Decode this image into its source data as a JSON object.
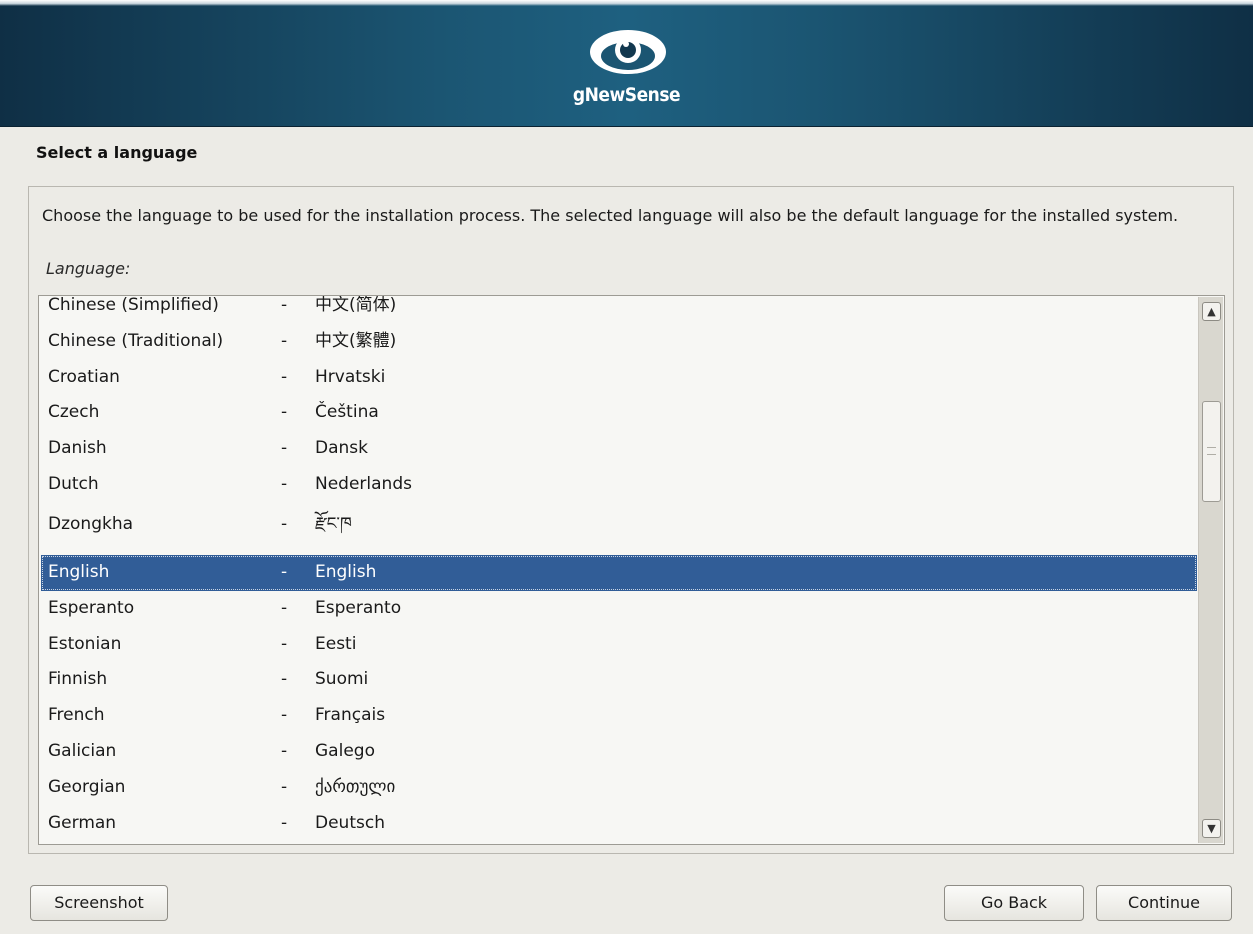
{
  "banner": {
    "logo_text": "gNewSense",
    "logo_icon": "eye-logo-icon",
    "colors": {
      "dark": "#0f2f45",
      "mid": "#1e6080"
    }
  },
  "page": {
    "title": "Select a language",
    "description": "Choose the language to be used for the installation process. The selected language will also be the default language for the installed system.",
    "list_label": "Language:"
  },
  "languages": [
    {
      "name": "Chinese (Simplified)",
      "dash": "-",
      "native": "中文(简体)"
    },
    {
      "name": "Chinese (Traditional)",
      "dash": "-",
      "native": "中文(繁體)"
    },
    {
      "name": "Croatian",
      "dash": "-",
      "native": "Hrvatski"
    },
    {
      "name": "Czech",
      "dash": "-",
      "native": "Čeština"
    },
    {
      "name": "Danish",
      "dash": "-",
      "native": "Dansk"
    },
    {
      "name": "Dutch",
      "dash": "-",
      "native": "Nederlands"
    },
    {
      "name": "Dzongkha",
      "dash": "-",
      "native": "རྫོང་ཁ"
    },
    {
      "name": "English",
      "dash": "-",
      "native": "English",
      "selected": true
    },
    {
      "name": "Esperanto",
      "dash": "-",
      "native": "Esperanto"
    },
    {
      "name": "Estonian",
      "dash": "-",
      "native": "Eesti"
    },
    {
      "name": "Finnish",
      "dash": "-",
      "native": "Suomi"
    },
    {
      "name": "French",
      "dash": "-",
      "native": "Français"
    },
    {
      "name": "Galician",
      "dash": "-",
      "native": "Galego"
    },
    {
      "name": "Georgian",
      "dash": "-",
      "native": "ქართული"
    },
    {
      "name": "German",
      "dash": "-",
      "native": "Deutsch"
    }
  ],
  "selection_color": "#315d97",
  "scrollbar": {
    "up_icon": "chevron-up-icon",
    "down_icon": "chevron-down-icon"
  },
  "buttons": {
    "screenshot": "Screenshot",
    "go_back": "Go Back",
    "continue": "Continue"
  }
}
